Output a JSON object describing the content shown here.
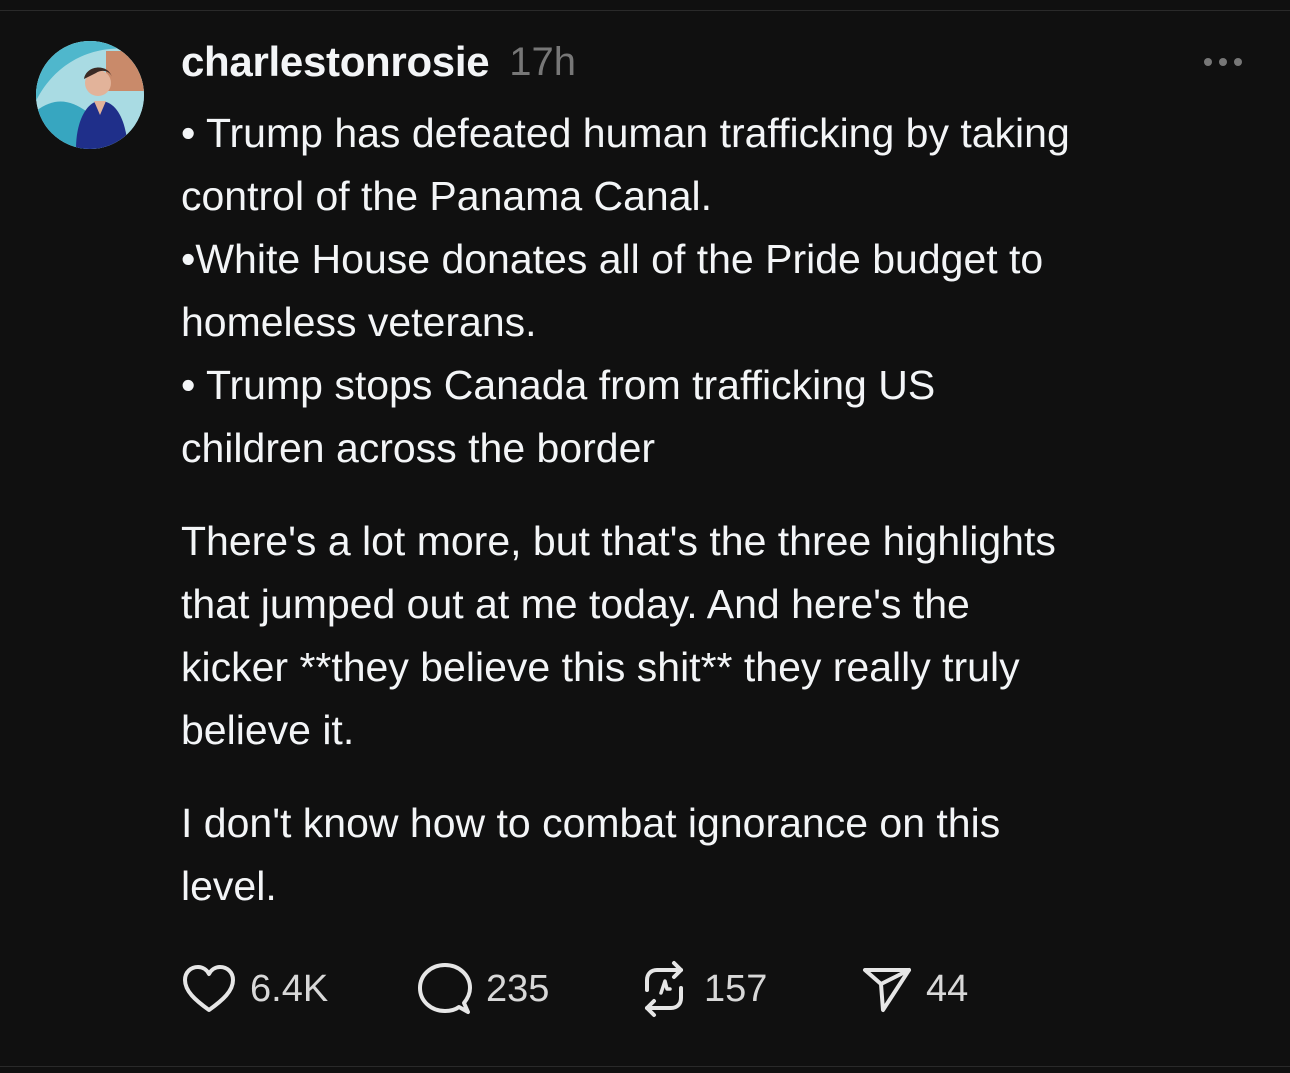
{
  "post": {
    "author": {
      "username": "charlestonrosie",
      "avatar_icon": "profile-photo"
    },
    "timestamp": "17h",
    "more_icon": "more-horizontal-icon",
    "body": [
      "• Trump has defeated human trafficking by taking",
      "control of the Panama Canal.",
      "•White House donates all of the Pride budget to",
      "homeless veterans.",
      "• Trump stops Canada from trafficking US",
      "children across the border",
      "There's a lot more, but that's the three highlights",
      "that jumped out at me today. And here's the",
      "kicker **they believe this shit** they really truly",
      "believe it.",
      "I don't know how to combat ignorance on this",
      "level."
    ],
    "actions": {
      "likes": {
        "icon": "heart-icon",
        "count": "6.4K"
      },
      "replies": {
        "icon": "comment-icon",
        "count": "235"
      },
      "reposts": {
        "icon": "repost-icon",
        "count": "157"
      },
      "shares": {
        "icon": "send-icon",
        "count": "44"
      }
    }
  },
  "colors": {
    "background": "#101010",
    "text_primary": "#f3f5f7",
    "text_secondary": "#777777",
    "divider": "#2a2a2a"
  }
}
